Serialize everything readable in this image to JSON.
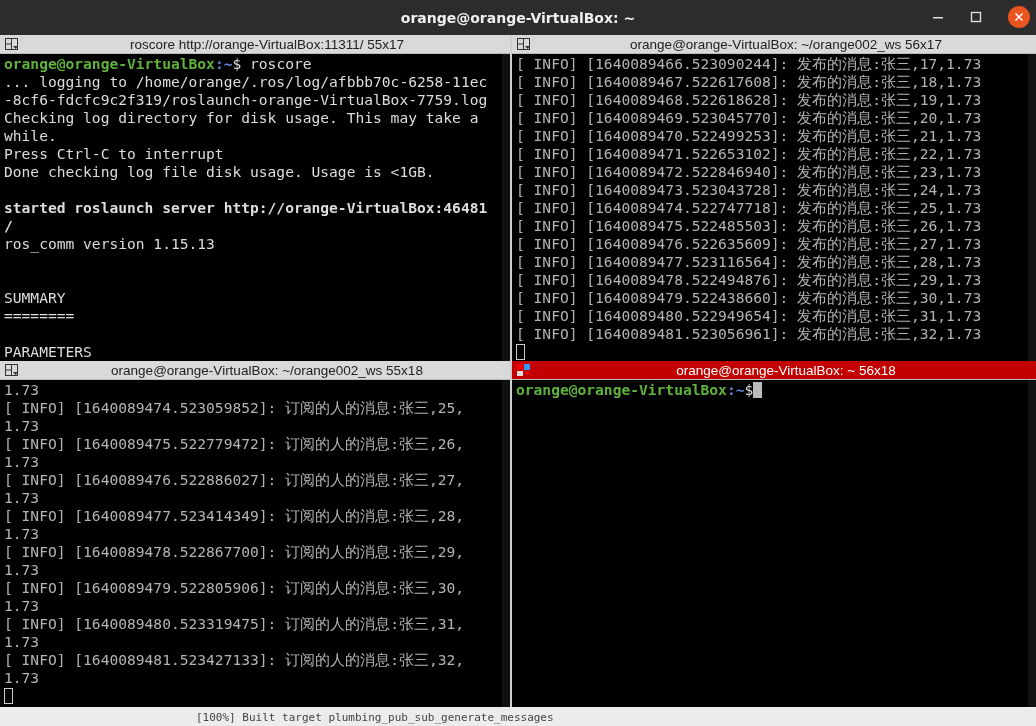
{
  "window": {
    "title": "orange@orange-VirtualBox: ~"
  },
  "panes": [
    {
      "title": "roscore http://orange-VirtualBox:11311/ 55x17",
      "focused": false,
      "cursor": false,
      "lines": [
        {
          "kind": "prompt",
          "user": "orange@orange-VirtualBox",
          "path": ":~",
          "symbol": "$",
          "command": " roscore"
        },
        {
          "kind": "text",
          "text": "... logging to /home/orange/.ros/log/afbbb70c-6258-11ec"
        },
        {
          "kind": "text",
          "text": "-8cf6-fdcfc9c2f319/roslaunch-orange-VirtualBox-7759.log"
        },
        {
          "kind": "text",
          "text": "Checking log directory for disk usage. This may take a"
        },
        {
          "kind": "text",
          "text": "while."
        },
        {
          "kind": "text",
          "text": "Press Ctrl-C to interrupt"
        },
        {
          "kind": "text",
          "text": "Done checking log file disk usage. Usage is <1GB."
        },
        {
          "kind": "blank"
        },
        {
          "kind": "bold",
          "text": "started roslaunch server http://orange-VirtualBox:46481"
        },
        {
          "kind": "bold",
          "text": "/"
        },
        {
          "kind": "text",
          "text": "ros_comm version 1.15.13"
        },
        {
          "kind": "blank"
        },
        {
          "kind": "blank"
        },
        {
          "kind": "text",
          "text": "SUMMARY"
        },
        {
          "kind": "text",
          "text": "========"
        },
        {
          "kind": "blank"
        },
        {
          "kind": "text",
          "text": "PARAMETERS"
        }
      ]
    },
    {
      "title": "orange@orange-VirtualBox: ~/orange002_ws 56x17",
      "focused": false,
      "cursor": true,
      "lines": [
        {
          "kind": "log",
          "text": "[ INFO] [1640089466.523090244]: 发布的消息:张三,17,1.73"
        },
        {
          "kind": "log",
          "text": "[ INFO] [1640089467.522617608]: 发布的消息:张三,18,1.73"
        },
        {
          "kind": "log",
          "text": "[ INFO] [1640089468.522618628]: 发布的消息:张三,19,1.73"
        },
        {
          "kind": "log",
          "text": "[ INFO] [1640089469.523045770]: 发布的消息:张三,20,1.73"
        },
        {
          "kind": "log",
          "text": "[ INFO] [1640089470.522499253]: 发布的消息:张三,21,1.73"
        },
        {
          "kind": "log",
          "text": "[ INFO] [1640089471.522653102]: 发布的消息:张三,22,1.73"
        },
        {
          "kind": "log",
          "text": "[ INFO] [1640089472.522846940]: 发布的消息:张三,23,1.73"
        },
        {
          "kind": "log",
          "text": "[ INFO] [1640089473.523043728]: 发布的消息:张三,24,1.73"
        },
        {
          "kind": "log",
          "text": "[ INFO] [1640089474.522747718]: 发布的消息:张三,25,1.73"
        },
        {
          "kind": "log",
          "text": "[ INFO] [1640089475.522485503]: 发布的消息:张三,26,1.73"
        },
        {
          "kind": "log",
          "text": "[ INFO] [1640089476.522635609]: 发布的消息:张三,27,1.73"
        },
        {
          "kind": "log",
          "text": "[ INFO] [1640089477.523116564]: 发布的消息:张三,28,1.73"
        },
        {
          "kind": "log",
          "text": "[ INFO] [1640089478.522494876]: 发布的消息:张三,29,1.73"
        },
        {
          "kind": "log",
          "text": "[ INFO] [1640089479.522438660]: 发布的消息:张三,30,1.73"
        },
        {
          "kind": "log",
          "text": "[ INFO] [1640089480.522949654]: 发布的消息:张三,31,1.73"
        },
        {
          "kind": "log",
          "text": "[ INFO] [1640089481.523056961]: 发布的消息:张三,32,1.73"
        }
      ]
    },
    {
      "title": "orange@orange-VirtualBox: ~/orange002_ws 55x18",
      "focused": false,
      "cursor": true,
      "lines": [
        {
          "kind": "log",
          "text": "1.73"
        },
        {
          "kind": "log",
          "text": "[ INFO] [1640089474.523059852]: 订阅的人的消息:张三,25,"
        },
        {
          "kind": "log",
          "text": "1.73"
        },
        {
          "kind": "log",
          "text": "[ INFO] [1640089475.522779472]: 订阅的人的消息:张三,26,"
        },
        {
          "kind": "log",
          "text": "1.73"
        },
        {
          "kind": "log",
          "text": "[ INFO] [1640089476.522886027]: 订阅的人的消息:张三,27,"
        },
        {
          "kind": "log",
          "text": "1.73"
        },
        {
          "kind": "log",
          "text": "[ INFO] [1640089477.523414349]: 订阅的人的消息:张三,28,"
        },
        {
          "kind": "log",
          "text": "1.73"
        },
        {
          "kind": "log",
          "text": "[ INFO] [1640089478.522867700]: 订阅的人的消息:张三,29,"
        },
        {
          "kind": "log",
          "text": "1.73"
        },
        {
          "kind": "log",
          "text": "[ INFO] [1640089479.522805906]: 订阅的人的消息:张三,30,"
        },
        {
          "kind": "log",
          "text": "1.73"
        },
        {
          "kind": "log",
          "text": "[ INFO] [1640089480.523319475]: 订阅的人的消息:张三,31,"
        },
        {
          "kind": "log",
          "text": "1.73"
        },
        {
          "kind": "log",
          "text": "[ INFO] [1640089481.523427133]: 订阅的人的消息:张三,32,"
        },
        {
          "kind": "log",
          "text": "1.73"
        }
      ]
    },
    {
      "title": "orange@orange-VirtualBox: ~ 56x18",
      "focused": true,
      "cursor": true,
      "lines": [
        {
          "kind": "prompt",
          "user": "orange@orange-VirtualBox",
          "path": ":~",
          "symbol": "$"
        }
      ]
    }
  ],
  "background_text": "[100%] Built target plumbing_pub_sub_generate_messages"
}
